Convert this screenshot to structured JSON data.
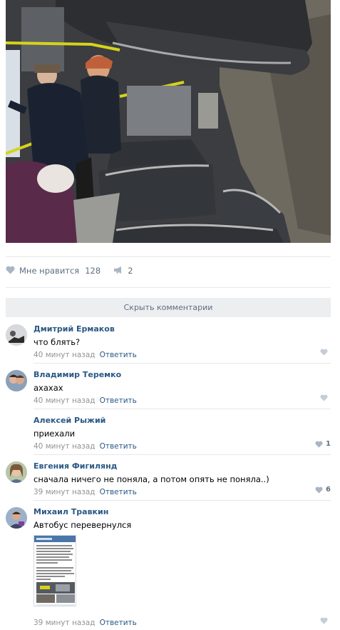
{
  "post": {
    "likes_label": "Мне нравится",
    "likes_count": "128",
    "reposts_count": "2"
  },
  "hide_comments_label": "Скрыть комментарии",
  "comments": [
    {
      "author": "Дмитрий Ермаков",
      "text": "что блять?",
      "time": "40 минут назад",
      "reply": "Ответить",
      "likes": ""
    },
    {
      "author": "Владимир Теремко",
      "text": "ахахах",
      "time": "40 минут назад",
      "reply": "Ответить",
      "likes": ""
    },
    {
      "author": "Алексей Рыжий",
      "text": "приехали",
      "time": "40 минут назад",
      "reply": "Ответить",
      "likes": "1"
    },
    {
      "author": "Евгения Фигилянд",
      "text": "сначала ничего не поняла, а потом опять не поняла..)",
      "time": "39 минут назад",
      "reply": "Ответить",
      "likes": "6"
    },
    {
      "author": "Михаил Травкин",
      "text": "Автобус перевернулся",
      "time": "39 минут назад",
      "reply": "Ответить",
      "likes": ""
    }
  ],
  "colors": {
    "link": "#2a5885",
    "muted": "#939393",
    "action": "#5e6f82",
    "bar": "#edeef0"
  },
  "icons": {
    "like": "heart-icon",
    "repost": "megaphone-icon"
  }
}
